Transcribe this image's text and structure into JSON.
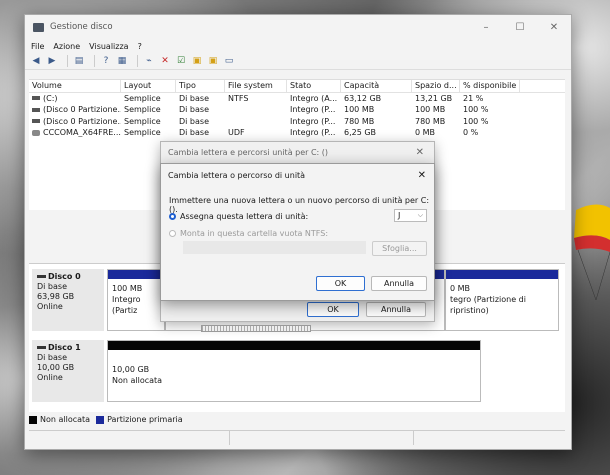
{
  "window": {
    "title": "Gestione disco",
    "controls": [
      "–",
      "☐",
      "✕"
    ]
  },
  "menu": [
    "File",
    "Azione",
    "Visualizza",
    "?"
  ],
  "table": {
    "headers": [
      "Volume",
      "Layout",
      "Tipo",
      "File system",
      "Stato",
      "Capacità",
      "Spazio d...",
      "% disponibile"
    ],
    "rows": [
      [
        "(C:)",
        "Semplice",
        "Di base",
        "NTFS",
        "Integro (A...",
        "63,12 GB",
        "13,21 GB",
        "21 %"
      ],
      [
        "(Disco 0 Partizione...",
        "Semplice",
        "Di base",
        "",
        "Integro (P...",
        "100 MB",
        "100 MB",
        "100 %"
      ],
      [
        "(Disco 0 Partizione...",
        "Semplice",
        "Di base",
        "",
        "Integro (P...",
        "780 MB",
        "780 MB",
        "100 %"
      ],
      [
        "CCCOMA_X64FRE...",
        "Semplice",
        "Di base",
        "UDF",
        "Integro (P...",
        "6,25 GB",
        "0 MB",
        "0 %"
      ]
    ]
  },
  "disks": [
    {
      "name": "Disco 0",
      "type": "Di base",
      "size": "63,98 GB",
      "status": "Online",
      "part1_line1": "100 MB",
      "part1_line2": "Integro (Partiz",
      "part3_line1": "0 MB",
      "part3_line2": "tegro (Partizione di ripristino)"
    },
    {
      "name": "Disco 1",
      "type": "Di base",
      "size": "10,00 GB",
      "status": "Online",
      "part1_line1": "10,00 GB",
      "part1_line2": "Non allocata"
    }
  ],
  "legend": {
    "unallocated": "Non allocata",
    "primary": "Partizione primaria",
    "unallocated_color": "#050505",
    "primary_color": "#1b2a9b"
  },
  "dialog_back": {
    "title": "Cambia lettera e percorsi unità per C: ()",
    "ok": "OK",
    "cancel": "Annulla"
  },
  "dialog": {
    "title": "Cambia lettera o percorso di unità",
    "description": "Immettere una nuova lettera o un nuovo percorso di unità per C: ().",
    "assign_label": "Assegna questa lettera di unità:",
    "drive_letter": "J",
    "mount_label": "Monta in questa cartella vuota NTFS:",
    "browse": "Sfoglia...",
    "ok": "OK",
    "cancel": "Annulla"
  }
}
